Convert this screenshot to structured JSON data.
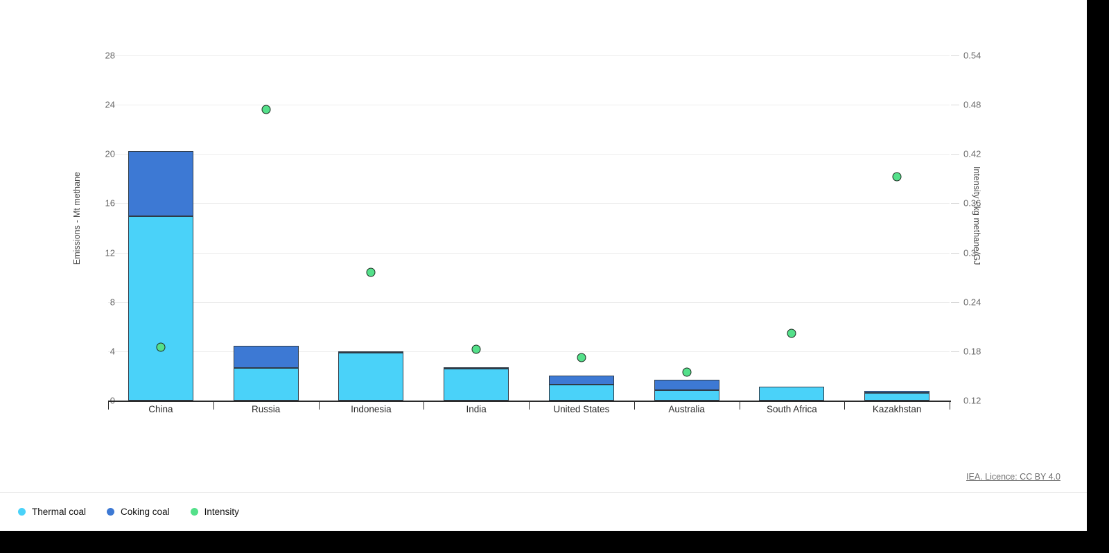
{
  "chart_data": {
    "type": "bar",
    "subtype": "stacked-bar-with-scatter-overlay",
    "title": "",
    "xlabel": "",
    "ylabel": "Emissions - Mt methane",
    "y2label": "Intensity - kg methane/GJ",
    "categories": [
      "China",
      "Russia",
      "Indonesia",
      "India",
      "United States",
      "Australia",
      "South Africa",
      "Kazakhstan"
    ],
    "series": [
      {
        "name": "Thermal coal",
        "axis": "left",
        "color": "#4ad2f9",
        "values": [
          14.95,
          2.65,
          3.9,
          2.6,
          1.3,
          0.85,
          1.15,
          0.6
        ]
      },
      {
        "name": "Coking coal",
        "axis": "left",
        "color": "#3d79d4",
        "values": [
          5.3,
          1.8,
          0.1,
          0.1,
          0.72,
          0.85,
          0.0,
          0.2
        ]
      },
      {
        "name": "Intensity",
        "axis": "right",
        "color": "#54e08a",
        "type": "scatter",
        "values": [
          0.185,
          0.474,
          0.276,
          0.182,
          0.172,
          0.155,
          0.202,
          0.392
        ]
      }
    ],
    "totals": [
      20.25,
      4.45,
      4.0,
      2.7,
      2.02,
      1.7,
      1.15,
      0.8
    ],
    "ylim": [
      0,
      28
    ],
    "yticks": [
      0,
      4,
      8,
      12,
      16,
      20,
      24,
      28
    ],
    "ytick_labels": [
      "0",
      "4",
      "8",
      "12",
      "16",
      "20",
      "24",
      "28"
    ],
    "y2lim": [
      0.12,
      0.54
    ],
    "y2ticks": [
      0.12,
      0.18,
      0.24,
      0.3,
      0.36,
      0.42,
      0.48,
      0.54
    ],
    "y2tick_labels": [
      "0.12",
      "0.18",
      "0.24",
      "0.3",
      "0.36",
      "0.42",
      "0.48",
      "0.54"
    ],
    "grid": true,
    "legend_position": "bottom-left"
  },
  "legend": {
    "items": [
      {
        "label": "Thermal coal",
        "color": "#4ad2f9"
      },
      {
        "label": "Coking coal",
        "color": "#3d79d4"
      },
      {
        "label": "Intensity",
        "color": "#54e08a"
      }
    ]
  },
  "footer": {
    "licence": "IEA. Licence: CC BY 4.0"
  }
}
